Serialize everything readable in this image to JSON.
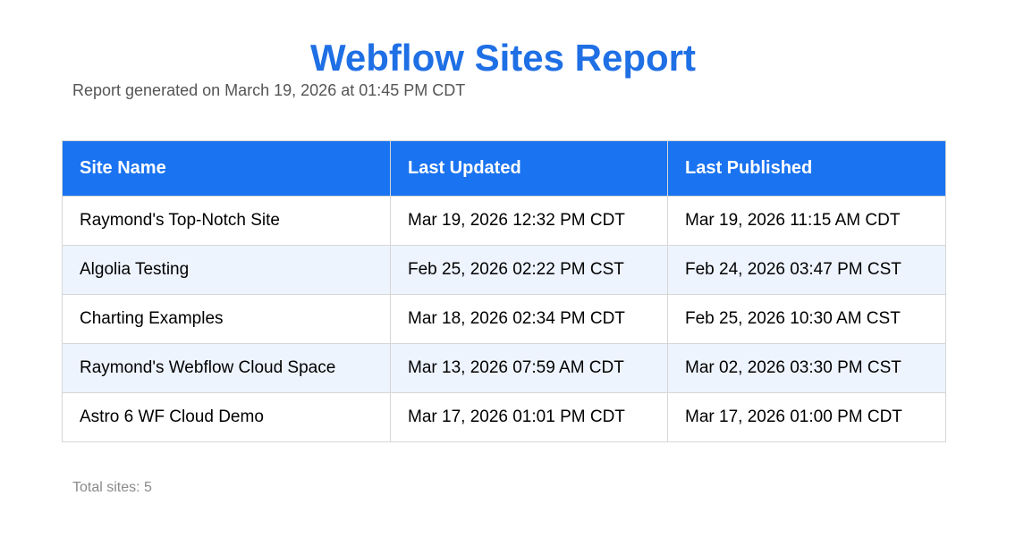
{
  "report": {
    "title": "Webflow Sites Report",
    "generated": "Report generated on March 19, 2026 at 01:45 PM CDT",
    "total": "Total sites: 5"
  },
  "table": {
    "headers": [
      "Site Name",
      "Last Updated",
      "Last Published"
    ],
    "rows": [
      [
        "Raymond's Top-Notch Site",
        "Mar 19, 2026 12:32 PM CDT",
        "Mar 19, 2026 11:15 AM CDT"
      ],
      [
        "Algolia Testing",
        "Feb 25, 2026 02:22 PM CST",
        "Feb 24, 2026 03:47 PM CST"
      ],
      [
        "Charting Examples",
        "Mar 18, 2026 02:34 PM CDT",
        "Feb 25, 2026 10:30 AM CST"
      ],
      [
        "Raymond's Webflow Cloud Space",
        "Mar 13, 2026 07:59 AM CDT",
        "Mar 02, 2026 03:30 PM CST"
      ],
      [
        "Astro 6 WF Cloud Demo",
        "Mar 17, 2026 01:01 PM CDT",
        "Mar 17, 2026 01:00 PM CDT"
      ]
    ]
  },
  "colors": {
    "title": "#1f6fe5",
    "header_bg": "#1a73f0",
    "alt_row_bg": "#eef4fe"
  }
}
